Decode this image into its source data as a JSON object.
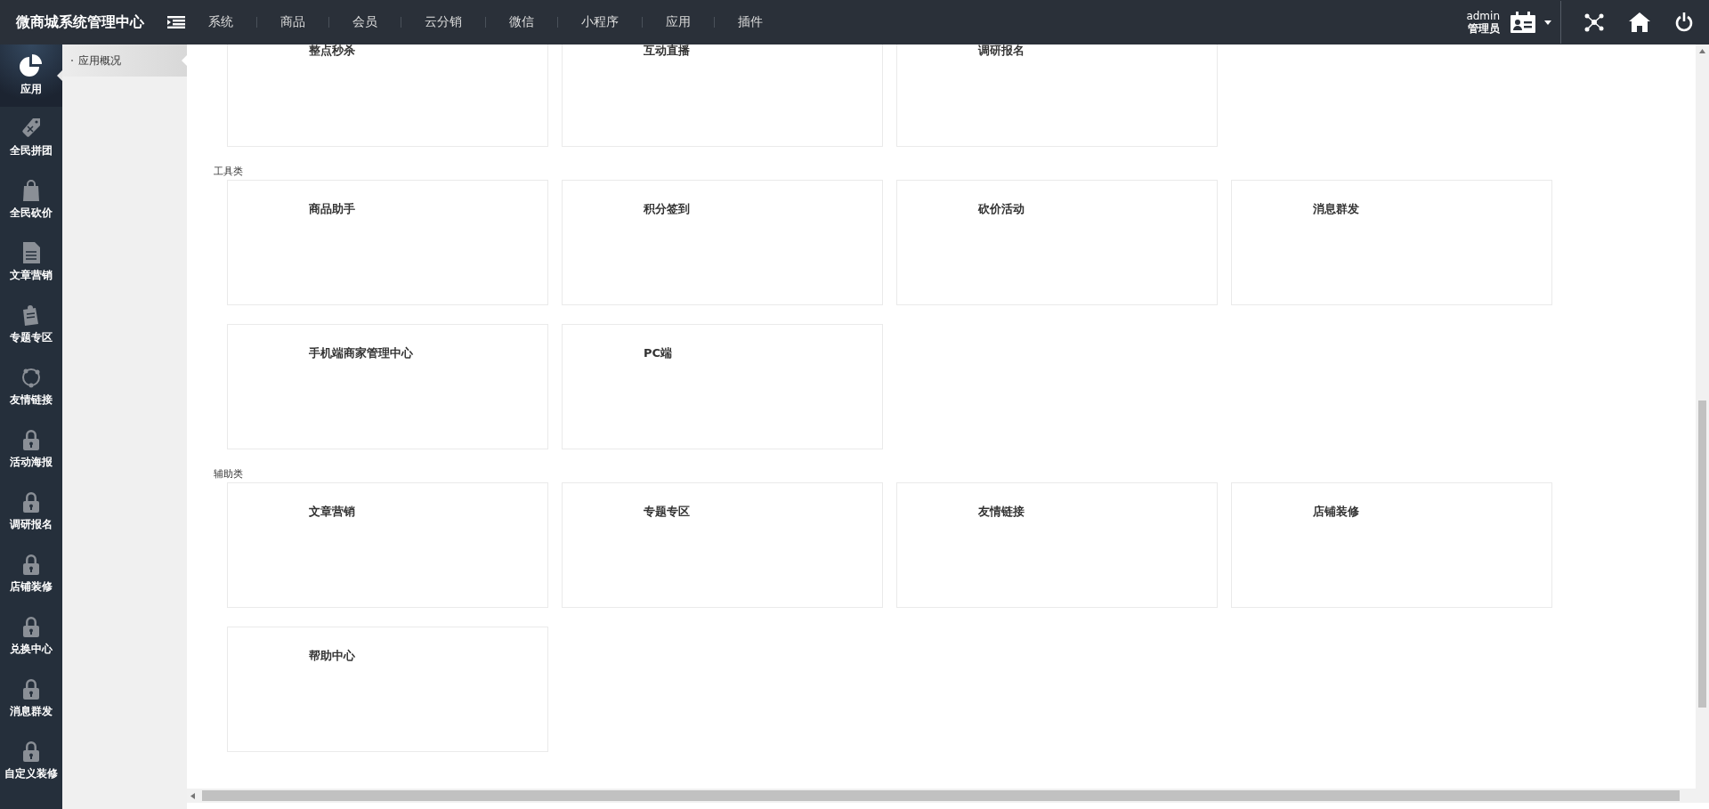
{
  "topbar": {
    "title": "微商城系统管理中心",
    "nav": [
      {
        "label": "系统"
      },
      {
        "label": "商品"
      },
      {
        "label": "会员"
      },
      {
        "label": "云分销"
      },
      {
        "label": "微信"
      },
      {
        "label": "小程序"
      },
      {
        "label": "应用"
      },
      {
        "label": "插件"
      }
    ],
    "user": {
      "name": "admin",
      "role": "管理员"
    }
  },
  "sidebar": {
    "items": [
      {
        "label": "应用",
        "selected": true,
        "locked": false
      },
      {
        "label": "全民拼团",
        "selected": false,
        "locked": false
      },
      {
        "label": "全民砍价",
        "selected": false,
        "locked": false
      },
      {
        "label": "文章营销",
        "selected": false,
        "locked": false
      },
      {
        "label": "专题专区",
        "selected": false,
        "locked": false
      },
      {
        "label": "友情链接",
        "selected": false,
        "locked": false
      },
      {
        "label": "活动海报",
        "selected": false,
        "locked": true
      },
      {
        "label": "调研报名",
        "selected": false,
        "locked": true
      },
      {
        "label": "店铺装修",
        "selected": false,
        "locked": true
      },
      {
        "label": "兑换中心",
        "selected": false,
        "locked": true
      },
      {
        "label": "消息群发",
        "selected": false,
        "locked": true
      },
      {
        "label": "自定义装修",
        "selected": false,
        "locked": true
      }
    ]
  },
  "subnav": {
    "items": [
      {
        "label": "应用概况",
        "selected": true
      }
    ]
  },
  "sections": [
    {
      "cards": [
        {
          "title": "整点秒杀"
        },
        {
          "title": "互动直播"
        },
        {
          "title": "调研报名"
        }
      ]
    },
    {
      "label": "工具类",
      "cards": [
        {
          "title": "商品助手"
        },
        {
          "title": "积分签到"
        },
        {
          "title": "砍价活动"
        },
        {
          "title": "消息群发"
        },
        {
          "title": "手机端商家管理中心"
        },
        {
          "title": "PC端"
        }
      ]
    },
    {
      "label": "辅助类",
      "cards": [
        {
          "title": "文章营销"
        },
        {
          "title": "专题专区"
        },
        {
          "title": "友情链接"
        },
        {
          "title": "店铺装修"
        },
        {
          "title": "帮助中心"
        }
      ]
    }
  ]
}
